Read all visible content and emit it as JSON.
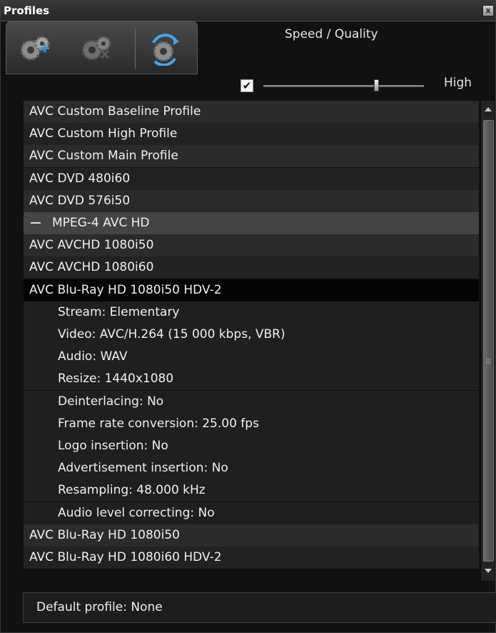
{
  "window": {
    "title": "Profiles",
    "close_label": "x"
  },
  "toolbar": {
    "tools": [
      "add-profile-gears-icon",
      "remove-profile-gears-icon",
      "refresh-profile-gears-icon"
    ]
  },
  "speed_quality": {
    "label": "Speed / Quality",
    "checked": true,
    "value_label": "High",
    "level": 0.7
  },
  "profiles": {
    "rows": [
      {
        "text": "AVC Custom Baseline Profile",
        "kind": "alt"
      },
      {
        "text": "AVC Custom High Profile",
        "kind": "base"
      },
      {
        "text": "AVC Custom Main Profile",
        "kind": "alt"
      },
      {
        "text": "AVC DVD 480i60",
        "kind": "base"
      },
      {
        "text": "AVC DVD 576i50",
        "kind": "alt"
      },
      {
        "text": "MPEG-4 AVC HD",
        "kind": "group"
      },
      {
        "text": "AVC AVCHD 1080i50",
        "kind": "alt"
      },
      {
        "text": "AVC AVCHD 1080i60",
        "kind": "base"
      },
      {
        "text": "AVC Blu-Ray HD 1080i50 HDV-2",
        "kind": "selected"
      },
      {
        "text": "Stream: Elementary",
        "kind": "detail"
      },
      {
        "text": "Video: AVC/H.264 (15 000 kbps, VBR)",
        "kind": "detail"
      },
      {
        "text": "Audio: WAV",
        "kind": "detail"
      },
      {
        "text": "Resize: 1440x1080",
        "kind": "detail"
      },
      {
        "text": "Deinterlacing: No",
        "kind": "detail"
      },
      {
        "text": "Frame rate conversion: 25.00 fps",
        "kind": "detail"
      },
      {
        "text": "Logo insertion: No",
        "kind": "detail"
      },
      {
        "text": "Advertisement insertion: No",
        "kind": "detail"
      },
      {
        "text": "Resampling: 48.000 kHz",
        "kind": "detail"
      },
      {
        "text": "Audio level correcting: No",
        "kind": "detail"
      },
      {
        "text": "AVC Blu-Ray HD 1080i50",
        "kind": "alt"
      },
      {
        "text": "AVC Blu-Ray HD 1080i60 HDV-2",
        "kind": "base"
      }
    ]
  },
  "footer": {
    "default_profile": "Default profile: None"
  },
  "colors": {
    "background": "#111111",
    "row_alt": "#2b2b2b",
    "row_base": "#222222",
    "group": "#444444",
    "selected": "#050505",
    "text": "#f0f0f0"
  }
}
